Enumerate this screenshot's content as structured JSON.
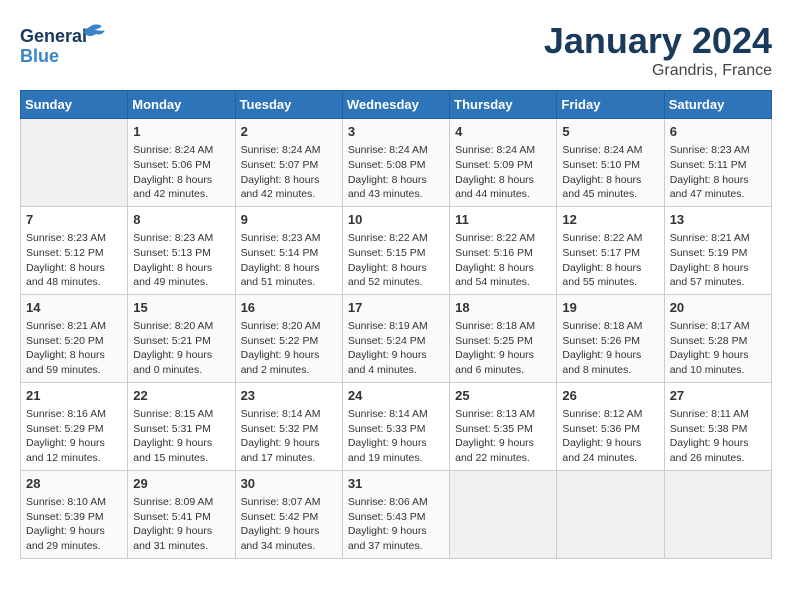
{
  "logo": {
    "line1": "General",
    "line2": "Blue"
  },
  "title": "January 2024",
  "location": "Grandris, France",
  "columns": [
    "Sunday",
    "Monday",
    "Tuesday",
    "Wednesday",
    "Thursday",
    "Friday",
    "Saturday"
  ],
  "weeks": [
    [
      {
        "day": "",
        "info": ""
      },
      {
        "day": "1",
        "info": "Sunrise: 8:24 AM\nSunset: 5:06 PM\nDaylight: 8 hours\nand 42 minutes."
      },
      {
        "day": "2",
        "info": "Sunrise: 8:24 AM\nSunset: 5:07 PM\nDaylight: 8 hours\nand 42 minutes."
      },
      {
        "day": "3",
        "info": "Sunrise: 8:24 AM\nSunset: 5:08 PM\nDaylight: 8 hours\nand 43 minutes."
      },
      {
        "day": "4",
        "info": "Sunrise: 8:24 AM\nSunset: 5:09 PM\nDaylight: 8 hours\nand 44 minutes."
      },
      {
        "day": "5",
        "info": "Sunrise: 8:24 AM\nSunset: 5:10 PM\nDaylight: 8 hours\nand 45 minutes."
      },
      {
        "day": "6",
        "info": "Sunrise: 8:23 AM\nSunset: 5:11 PM\nDaylight: 8 hours\nand 47 minutes."
      }
    ],
    [
      {
        "day": "7",
        "info": "Sunrise: 8:23 AM\nSunset: 5:12 PM\nDaylight: 8 hours\nand 48 minutes."
      },
      {
        "day": "8",
        "info": "Sunrise: 8:23 AM\nSunset: 5:13 PM\nDaylight: 8 hours\nand 49 minutes."
      },
      {
        "day": "9",
        "info": "Sunrise: 8:23 AM\nSunset: 5:14 PM\nDaylight: 8 hours\nand 51 minutes."
      },
      {
        "day": "10",
        "info": "Sunrise: 8:22 AM\nSunset: 5:15 PM\nDaylight: 8 hours\nand 52 minutes."
      },
      {
        "day": "11",
        "info": "Sunrise: 8:22 AM\nSunset: 5:16 PM\nDaylight: 8 hours\nand 54 minutes."
      },
      {
        "day": "12",
        "info": "Sunrise: 8:22 AM\nSunset: 5:17 PM\nDaylight: 8 hours\nand 55 minutes."
      },
      {
        "day": "13",
        "info": "Sunrise: 8:21 AM\nSunset: 5:19 PM\nDaylight: 8 hours\nand 57 minutes."
      }
    ],
    [
      {
        "day": "14",
        "info": "Sunrise: 8:21 AM\nSunset: 5:20 PM\nDaylight: 8 hours\nand 59 minutes."
      },
      {
        "day": "15",
        "info": "Sunrise: 8:20 AM\nSunset: 5:21 PM\nDaylight: 9 hours\nand 0 minutes."
      },
      {
        "day": "16",
        "info": "Sunrise: 8:20 AM\nSunset: 5:22 PM\nDaylight: 9 hours\nand 2 minutes."
      },
      {
        "day": "17",
        "info": "Sunrise: 8:19 AM\nSunset: 5:24 PM\nDaylight: 9 hours\nand 4 minutes."
      },
      {
        "day": "18",
        "info": "Sunrise: 8:18 AM\nSunset: 5:25 PM\nDaylight: 9 hours\nand 6 minutes."
      },
      {
        "day": "19",
        "info": "Sunrise: 8:18 AM\nSunset: 5:26 PM\nDaylight: 9 hours\nand 8 minutes."
      },
      {
        "day": "20",
        "info": "Sunrise: 8:17 AM\nSunset: 5:28 PM\nDaylight: 9 hours\nand 10 minutes."
      }
    ],
    [
      {
        "day": "21",
        "info": "Sunrise: 8:16 AM\nSunset: 5:29 PM\nDaylight: 9 hours\nand 12 minutes."
      },
      {
        "day": "22",
        "info": "Sunrise: 8:15 AM\nSunset: 5:31 PM\nDaylight: 9 hours\nand 15 minutes."
      },
      {
        "day": "23",
        "info": "Sunrise: 8:14 AM\nSunset: 5:32 PM\nDaylight: 9 hours\nand 17 minutes."
      },
      {
        "day": "24",
        "info": "Sunrise: 8:14 AM\nSunset: 5:33 PM\nDaylight: 9 hours\nand 19 minutes."
      },
      {
        "day": "25",
        "info": "Sunrise: 8:13 AM\nSunset: 5:35 PM\nDaylight: 9 hours\nand 22 minutes."
      },
      {
        "day": "26",
        "info": "Sunrise: 8:12 AM\nSunset: 5:36 PM\nDaylight: 9 hours\nand 24 minutes."
      },
      {
        "day": "27",
        "info": "Sunrise: 8:11 AM\nSunset: 5:38 PM\nDaylight: 9 hours\nand 26 minutes."
      }
    ],
    [
      {
        "day": "28",
        "info": "Sunrise: 8:10 AM\nSunset: 5:39 PM\nDaylight: 9 hours\nand 29 minutes."
      },
      {
        "day": "29",
        "info": "Sunrise: 8:09 AM\nSunset: 5:41 PM\nDaylight: 9 hours\nand 31 minutes."
      },
      {
        "day": "30",
        "info": "Sunrise: 8:07 AM\nSunset: 5:42 PM\nDaylight: 9 hours\nand 34 minutes."
      },
      {
        "day": "31",
        "info": "Sunrise: 8:06 AM\nSunset: 5:43 PM\nDaylight: 9 hours\nand 37 minutes."
      },
      {
        "day": "",
        "info": ""
      },
      {
        "day": "",
        "info": ""
      },
      {
        "day": "",
        "info": ""
      }
    ]
  ]
}
